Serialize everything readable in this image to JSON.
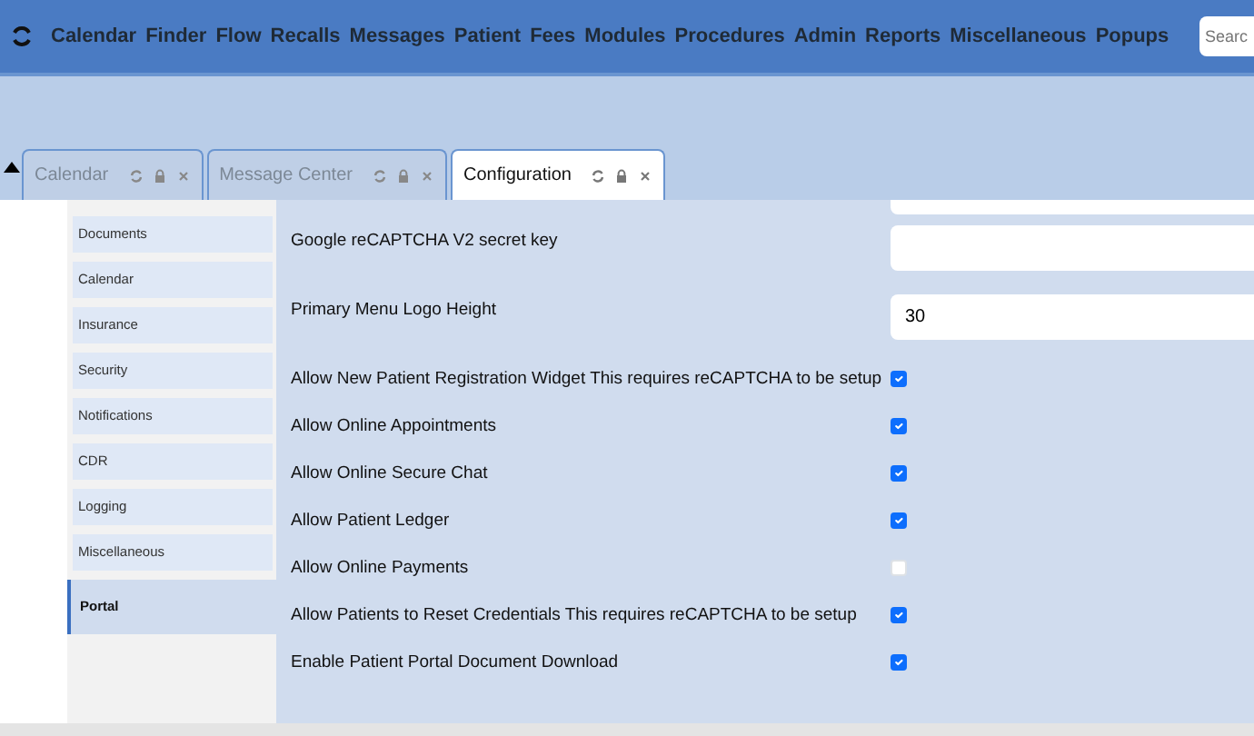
{
  "menu": [
    "Calendar",
    "Finder",
    "Flow",
    "Recalls",
    "Messages",
    "Patient",
    "Fees",
    "Modules",
    "Procedures",
    "Admin",
    "Reports",
    "Miscellaneous",
    "Popups"
  ],
  "search": {
    "placeholder": "Searc"
  },
  "tabs": [
    {
      "label": "Calendar",
      "selected": false
    },
    {
      "label": "Message Center",
      "selected": false
    },
    {
      "label": "Configuration",
      "selected": true
    }
  ],
  "sidebar": {
    "items": [
      {
        "label": "Documents",
        "selected": false
      },
      {
        "label": "Calendar",
        "selected": false
      },
      {
        "label": "Insurance",
        "selected": false
      },
      {
        "label": "Security",
        "selected": false
      },
      {
        "label": "Notifications",
        "selected": false
      },
      {
        "label": "CDR",
        "selected": false
      },
      {
        "label": "Logging",
        "selected": false
      },
      {
        "label": "Miscellaneous",
        "selected": false
      },
      {
        "label": "Portal",
        "selected": true
      }
    ]
  },
  "settings": [
    {
      "kind": "text"
    },
    {
      "kind": "text",
      "label": "Google reCAPTCHA V2 secret key"
    },
    {
      "kind": "text",
      "label": "Primary Menu Logo Height",
      "value": "30"
    },
    {
      "kind": "checkbox",
      "label": "Allow New Patient Registration Widget This requires reCAPTCHA to be setup",
      "checked": true
    },
    {
      "kind": "checkbox",
      "label": "Allow Online Appointments",
      "checked": true
    },
    {
      "kind": "checkbox",
      "label": "Allow Online Secure Chat",
      "checked": true
    },
    {
      "kind": "checkbox",
      "label": "Allow Patient Ledger",
      "checked": true
    },
    {
      "kind": "checkbox",
      "label": "Allow Online Payments",
      "checked": false
    },
    {
      "kind": "checkbox",
      "label": "Allow Patients to Reset Credentials This requires reCAPTCHA to be setup",
      "checked": true
    },
    {
      "kind": "checkbox",
      "label": "Enable Patient Portal Document Download",
      "checked": true
    }
  ]
}
